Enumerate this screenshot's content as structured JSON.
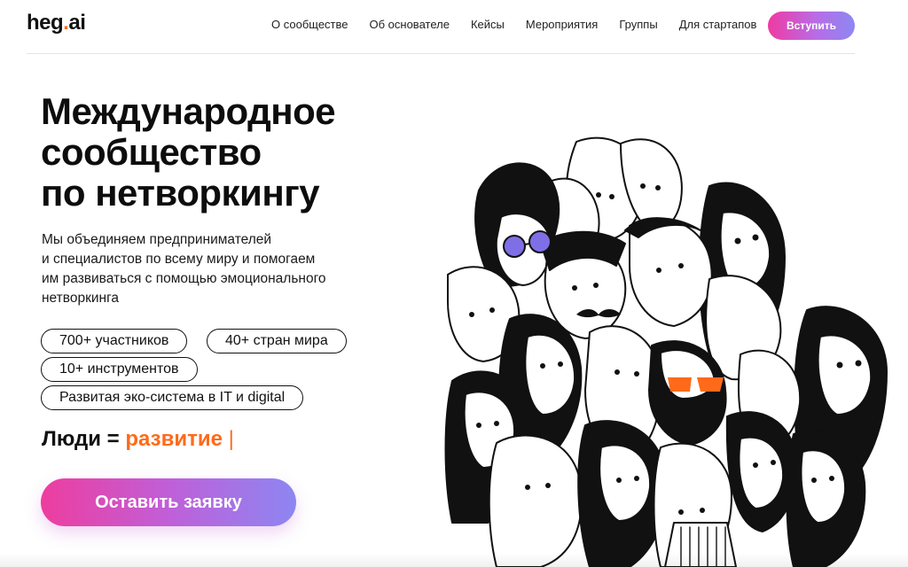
{
  "header": {
    "logo_part1": "heg",
    "logo_dot": ".",
    "logo_part2": "ai",
    "nav": [
      {
        "label": "О сообществе"
      },
      {
        "label": "Об основателе"
      },
      {
        "label": "Кейсы"
      },
      {
        "label": "Мероприятия"
      },
      {
        "label": "Группы"
      },
      {
        "label": "Для стартапов"
      }
    ],
    "join_label": "Вступить"
  },
  "hero": {
    "title_lines": [
      "Международное",
      "сообщество",
      "по нетворкингу"
    ],
    "desc_lines": [
      "Мы объединяем предпринимателей",
      "и специалистов по всему миру и помогаем",
      "им развиваться с помощью эмоционального",
      "нетворкинга"
    ],
    "pills": [
      "700+ участников",
      "40+ стран мира",
      "10+ инструментов",
      "Развитая эко-система в IT и digital"
    ],
    "tagline_prefix": "Люди = ",
    "tagline_accent": "развитие",
    "tagline_cursor": "|",
    "cta_label": "Оставить заявку"
  },
  "colors": {
    "accent_orange": "#ff6a1a",
    "gradient_pink": "#ee3d9e",
    "gradient_violet": "#8d86f2",
    "glasses_purple": "#7e6fe6"
  },
  "illustration": {
    "icon": "crowd-of-people-illustration"
  }
}
